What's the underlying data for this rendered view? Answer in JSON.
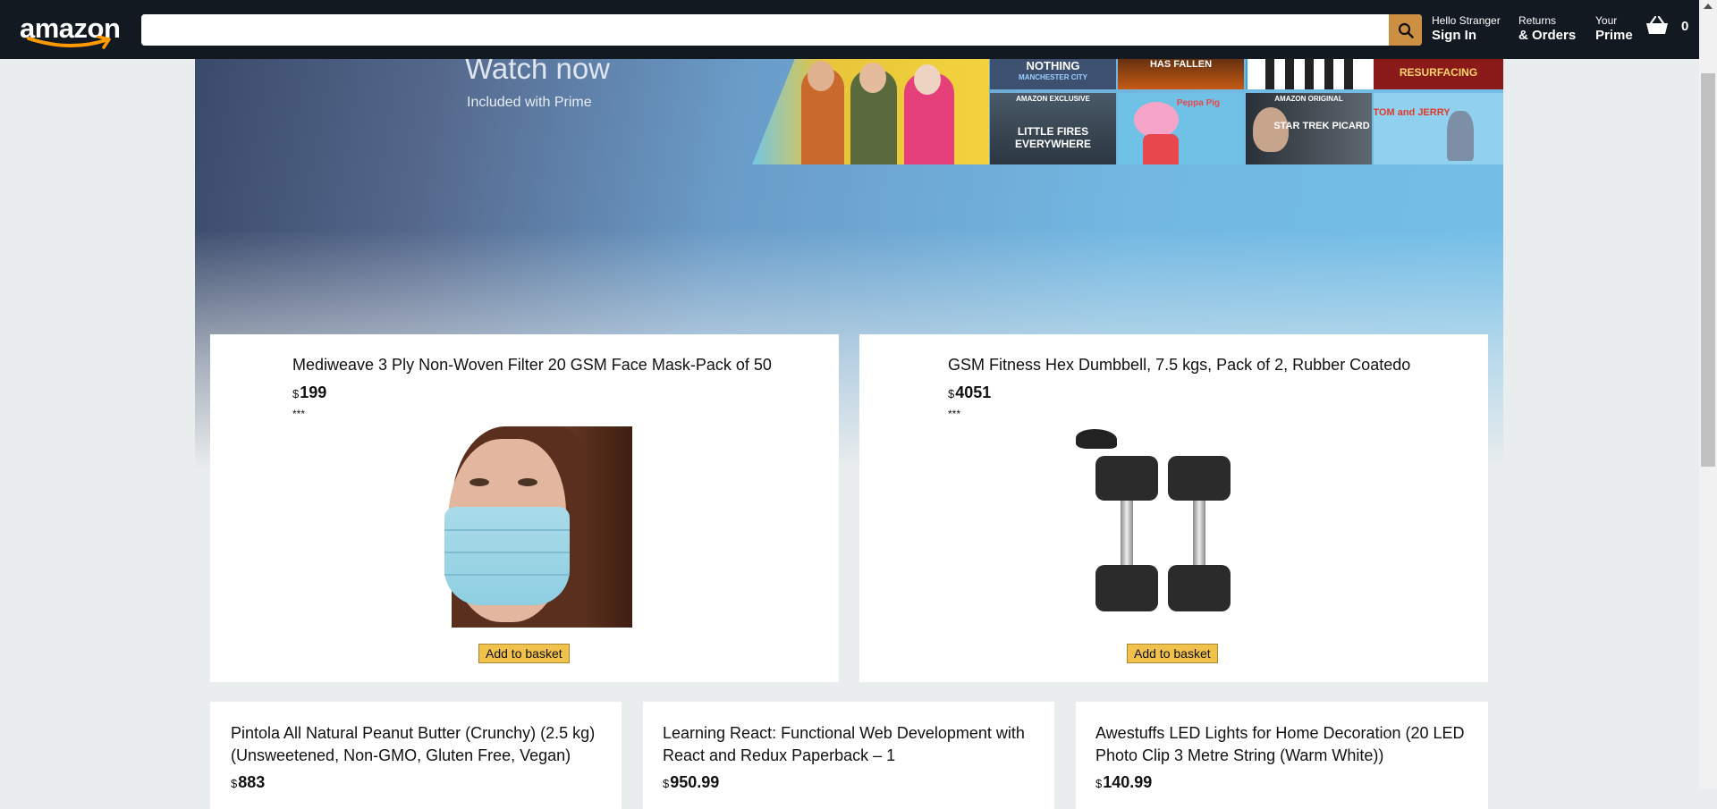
{
  "header": {
    "logo_text": "amazon",
    "search": {
      "value": "",
      "placeholder": ""
    },
    "signin": {
      "line1": "Hello Stranger",
      "line2": "Sign In"
    },
    "orders": {
      "line1": "Returns",
      "line2": "& Orders"
    },
    "prime": {
      "line1": "Your",
      "line2": "Prime"
    },
    "basket_count": "0"
  },
  "hero": {
    "title": "Watch now",
    "subtitle": "Included with Prime",
    "posters": [
      "NOTHING",
      "MANCHESTER CITY",
      "HAS FALLEN",
      "RESURFACING",
      "LITTLE FIRES EVERYWHERE",
      "AMAZON EXCLUSIVE",
      "Peppa Pig",
      "AMAZON ORIGINAL",
      "STAR TREK PICARD",
      "TOM and JERRY"
    ]
  },
  "products": [
    {
      "title": "Mediweave 3 Ply Non-Woven Filter 20 GSM Face Mask-Pack of 50",
      "currency": "$",
      "price": "199",
      "rating": "***",
      "button": "Add to basket"
    },
    {
      "title": "GSM Fitness Hex Dumbbell, 7.5 kgs, Pack of 2, Rubber Coatedo",
      "currency": "$",
      "price": "4051",
      "rating": "***",
      "button": "Add to basket"
    },
    {
      "title": "Pintola All Natural Peanut Butter (Crunchy) (2.5 kg) (Unsweetened, Non-GMO, Gluten Free, Vegan)",
      "currency": "$",
      "price": "883"
    },
    {
      "title": "Learning React: Functional Web Development with React and Redux Paperback – 1",
      "currency": "$",
      "price": "950.99"
    },
    {
      "title": "Awestuffs LED Lights for Home Decoration (20 LED Photo Clip 3 Metre String (Warm White))",
      "currency": "$",
      "price": "140.99"
    }
  ],
  "colors": {
    "header_bg": "#131921",
    "search_button": "#cd9042",
    "button_bg": "#f0c14b",
    "page_bg": "#eaeded"
  }
}
